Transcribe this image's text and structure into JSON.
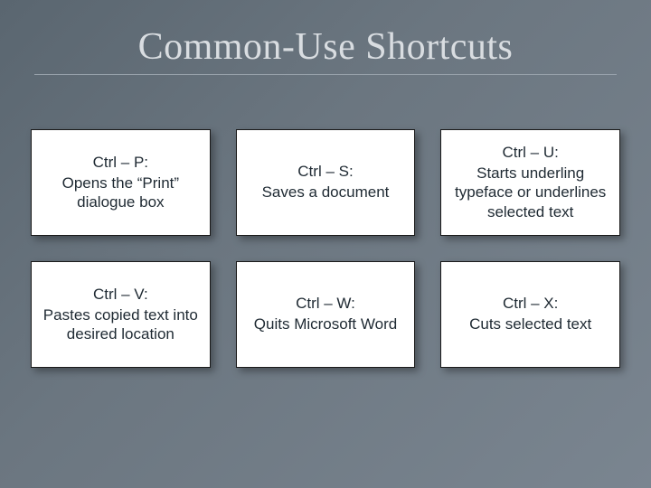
{
  "title": "Common-Use Shortcuts",
  "cells": [
    {
      "key": "Ctrl – P:",
      "desc": "Opens the “Print” dialogue box"
    },
    {
      "key": "Ctrl – S:",
      "desc": "Saves a document"
    },
    {
      "key": "Ctrl – U:",
      "desc": "Starts underling typeface or underlines selected text"
    },
    {
      "key": "Ctrl – V:",
      "desc": "Pastes copied text into desired location"
    },
    {
      "key": "Ctrl – W:",
      "desc": "Quits Microsoft Word"
    },
    {
      "key": "Ctrl – X:",
      "desc": "Cuts selected text"
    }
  ]
}
